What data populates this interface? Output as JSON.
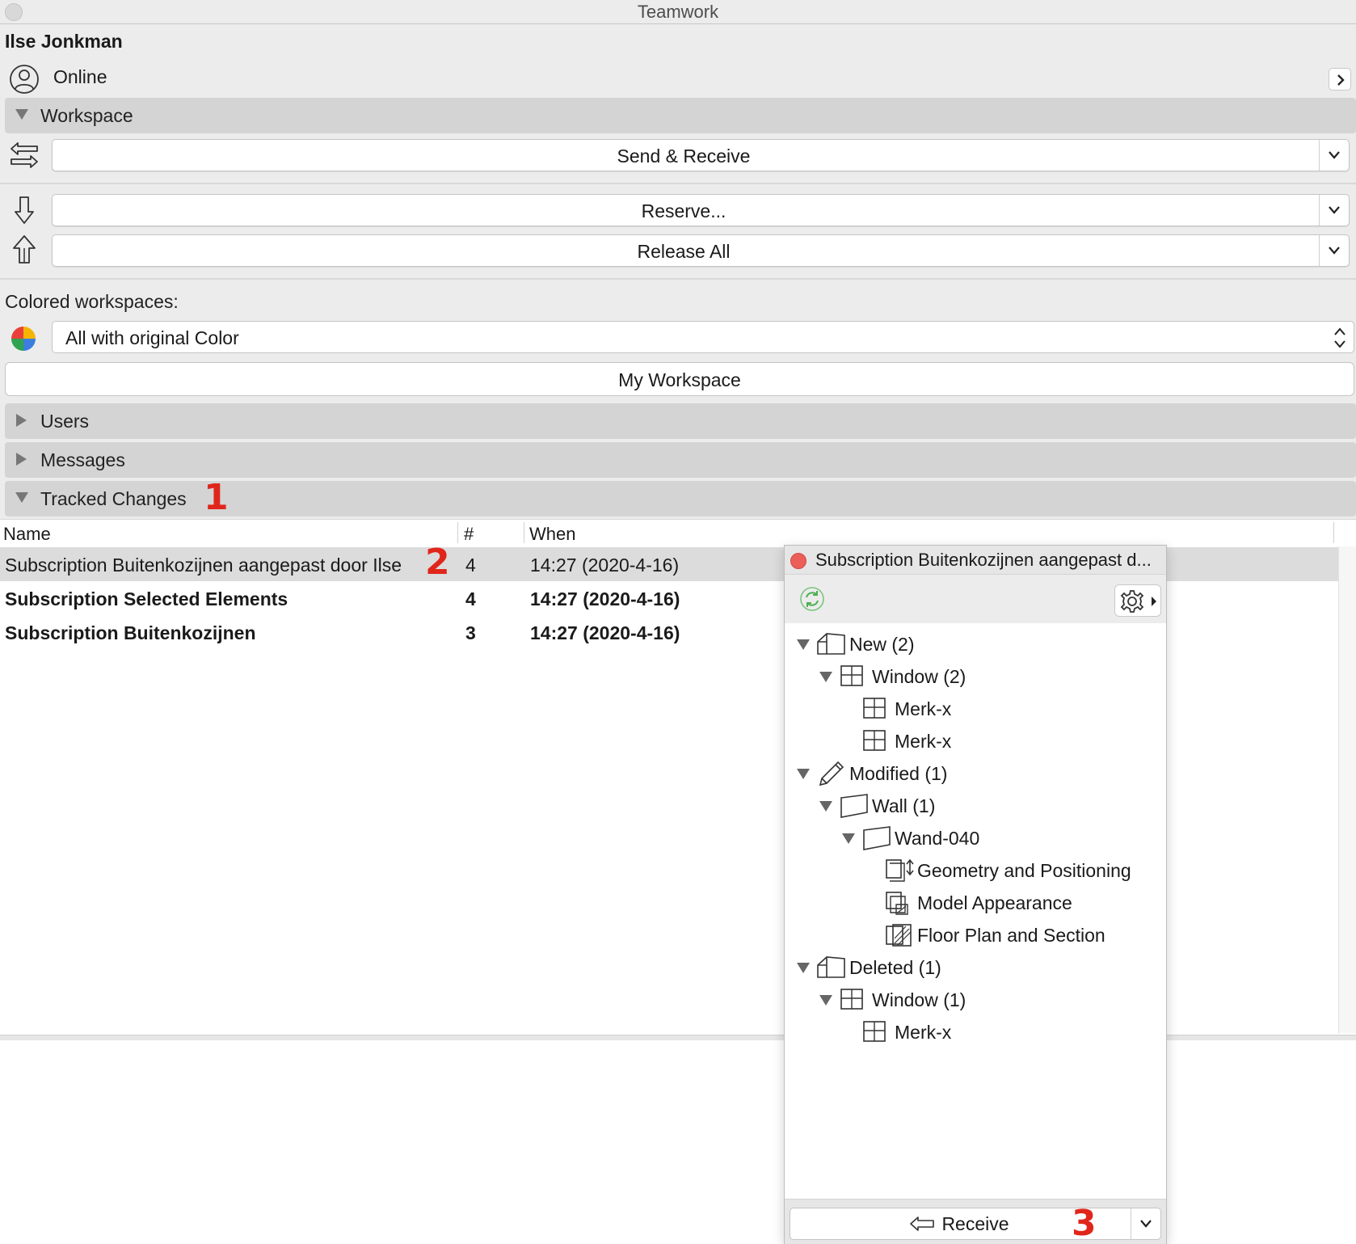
{
  "window": {
    "title": "Teamwork"
  },
  "user": {
    "name": "Ilse Jonkman",
    "status": "Online"
  },
  "workspace": {
    "section_label": "Workspace",
    "send_receive_label": "Send & Receive",
    "reserve_label": "Reserve...",
    "release_all_label": "Release All",
    "colored_workspaces_label": "Colored workspaces:",
    "color_mode_value": "All with original Color",
    "my_workspace_label": "My Workspace"
  },
  "sections": {
    "users": "Users",
    "messages": "Messages",
    "tracked_changes": "Tracked Changes"
  },
  "table": {
    "columns": {
      "name": "Name",
      "count": "#",
      "when": "When"
    },
    "rows": [
      {
        "name": "Subscription Buitenkozijnen aangepast door Ilse",
        "count": "4",
        "when": "14:27 (2020-4-16)",
        "bold": false,
        "selected": true
      },
      {
        "name": "Subscription Selected Elements",
        "count": "4",
        "when": "14:27 (2020-4-16)",
        "bold": true,
        "selected": false
      },
      {
        "name": "Subscription Buitenkozijnen",
        "count": "3",
        "when": "14:27 (2020-4-16)",
        "bold": true,
        "selected": false
      }
    ]
  },
  "annotations": {
    "a1": "1",
    "a2": "2",
    "a3": "3"
  },
  "popover": {
    "title": "Subscription Buitenkozijnen aangepast d...",
    "tree": [
      {
        "label": "New (2)",
        "icon": "building-icon",
        "expanded": true
      },
      {
        "label": "Window (2)",
        "icon": "window-icon",
        "expanded": true
      },
      {
        "label": "Merk-x",
        "icon": "window-icon"
      },
      {
        "label": "Merk-x",
        "icon": "window-icon"
      },
      {
        "label": "Modified (1)",
        "icon": "pencil-icon",
        "expanded": true
      },
      {
        "label": "Wall (1)",
        "icon": "wall-icon",
        "expanded": true
      },
      {
        "label": "Wand-040",
        "icon": "wall-icon",
        "expanded": true
      },
      {
        "label": "Geometry and Positioning",
        "icon": "geometry-icon"
      },
      {
        "label": "Model Appearance",
        "icon": "appearance-icon"
      },
      {
        "label": "Floor Plan and Section",
        "icon": "floorplan-icon"
      },
      {
        "label": "Deleted (1)",
        "icon": "building-icon",
        "expanded": true
      },
      {
        "label": "Window (1)",
        "icon": "window-icon",
        "expanded": true
      },
      {
        "label": "Merk-x",
        "icon": "window-icon"
      }
    ],
    "receive_label": "Receive"
  },
  "colors": {
    "annotation": "#e0261b",
    "record_dot": "#ec5f59",
    "refresh": "#4caf50"
  }
}
